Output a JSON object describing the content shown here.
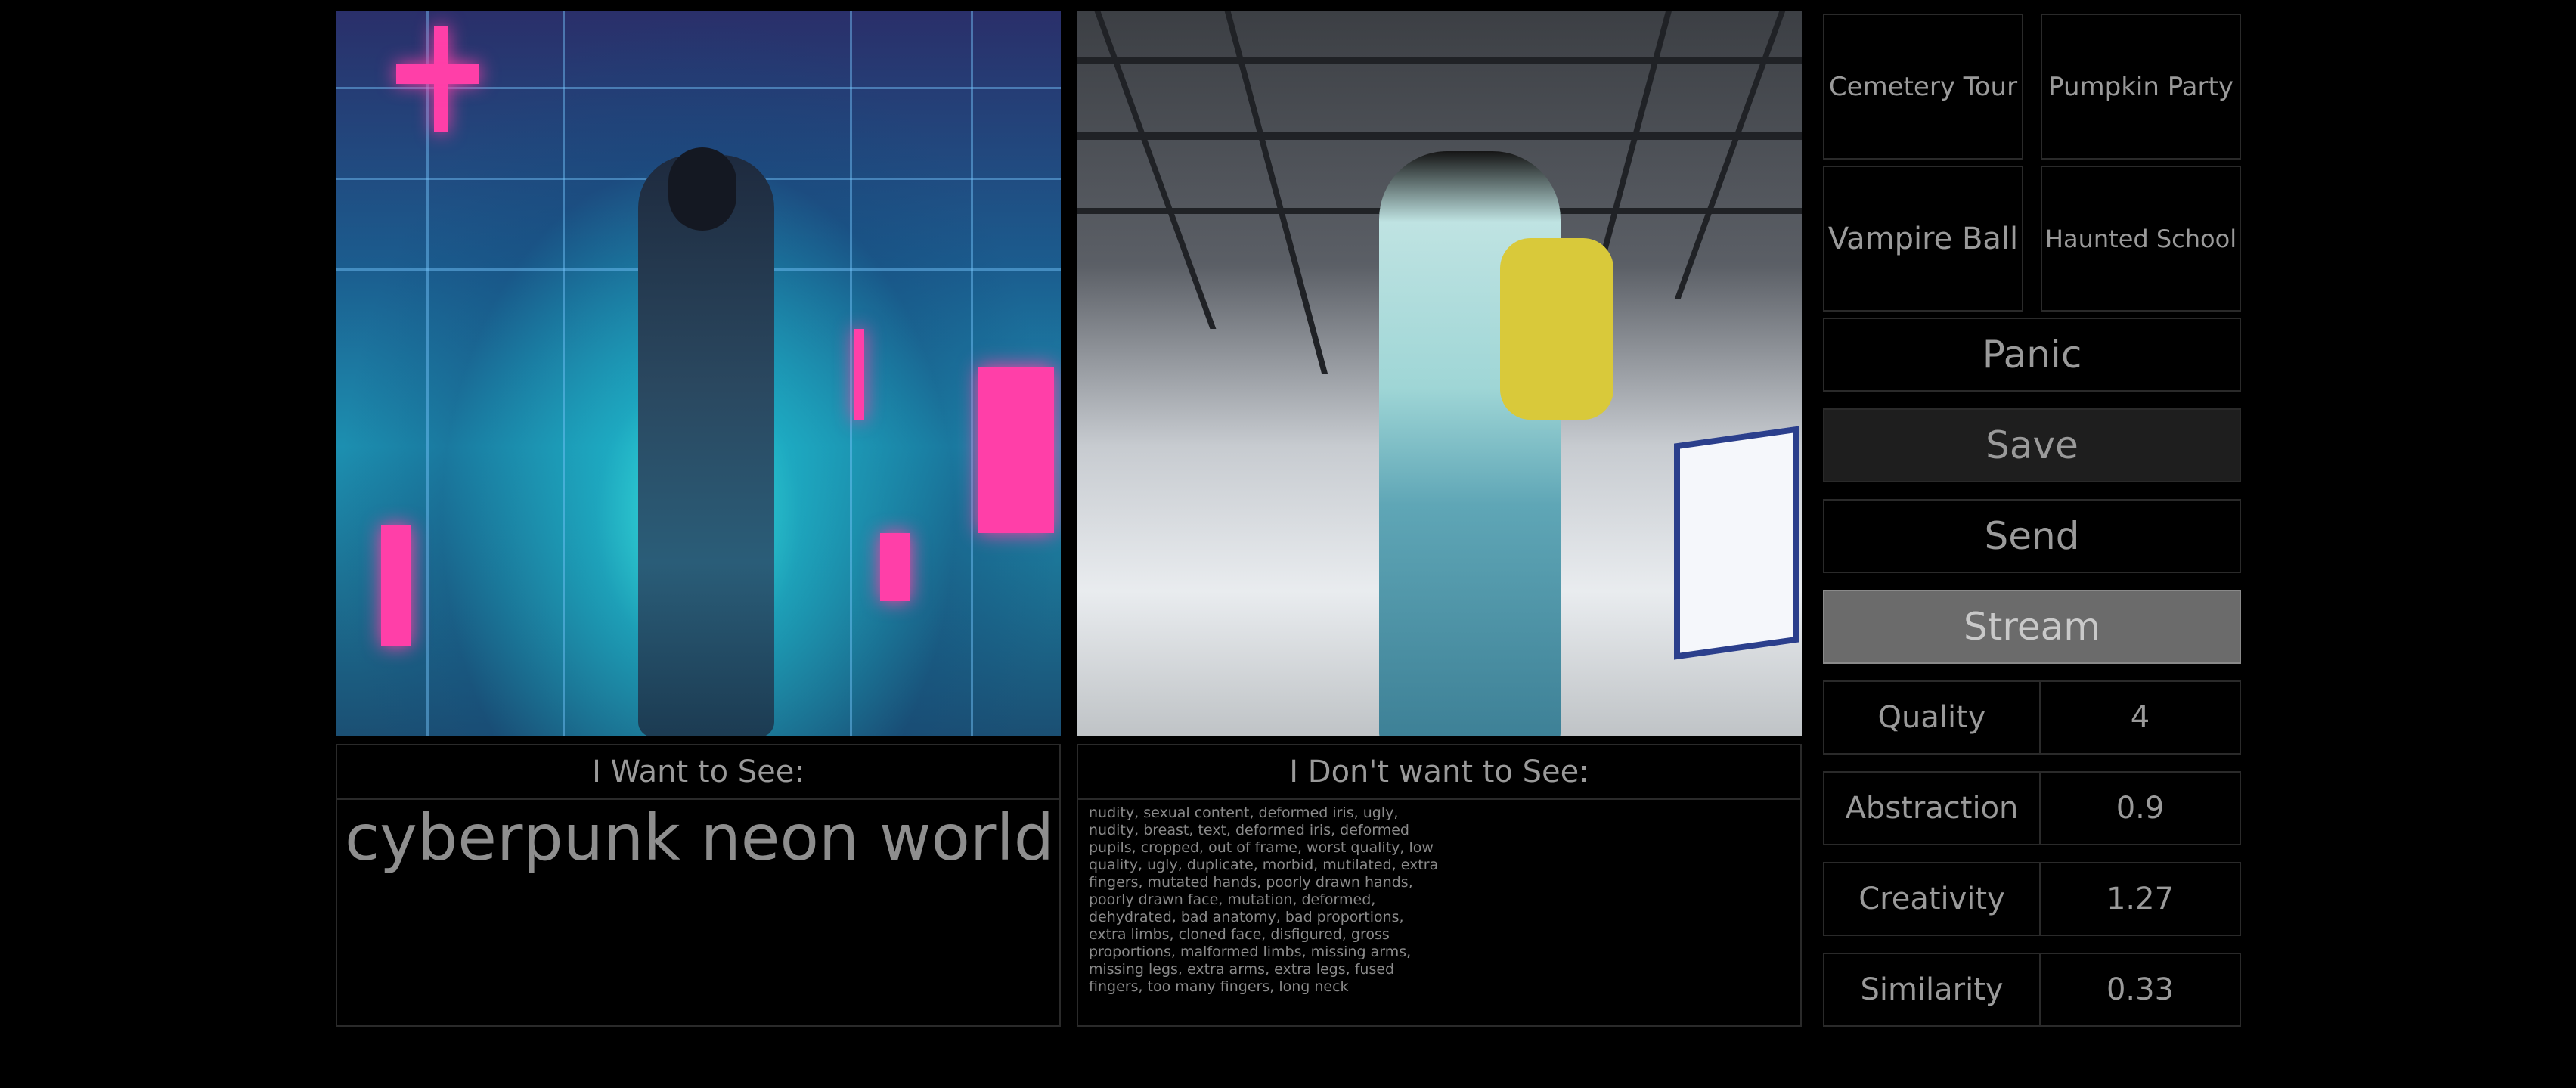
{
  "presets": [
    "Cemetery Tour",
    "Pumpkin Party",
    "Vampire Ball",
    "Haunted School"
  ],
  "buttons": {
    "panic": "Panic",
    "save": "Save",
    "send": "Send",
    "stream": "Stream"
  },
  "params": [
    {
      "label": "Quality",
      "value": "4"
    },
    {
      "label": "Abstraction",
      "value": "0.9"
    },
    {
      "label": "Creativity",
      "value": "1.27"
    },
    {
      "label": "Similarity",
      "value": "0.33"
    }
  ],
  "want": {
    "header": "I Want to See:",
    "text": "cyberpunk neon world"
  },
  "dont_want": {
    "header": "I Don't want to See:",
    "text": "nudity, sexual content, deformed iris, ugly, nudity, breast, text, deformed iris, deformed pupils, cropped, out of frame, worst quality, low quality, ugly, duplicate, morbid, mutilated, extra fingers, mutated hands, poorly drawn hands, poorly drawn face, mutation, deformed, dehydrated, bad anatomy, bad proportions, extra limbs, cloned face, disfigured, gross proportions, malformed limbs, missing arms, missing legs, extra arms, extra legs, fused fingers, too many fingers, long neck"
  }
}
